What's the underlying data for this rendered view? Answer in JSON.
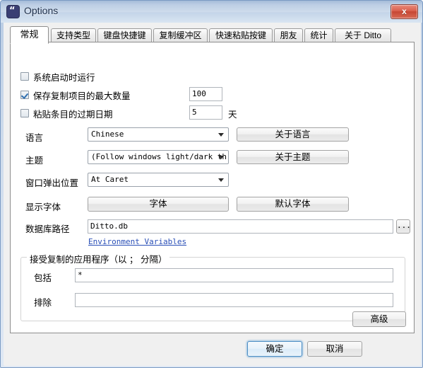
{
  "window": {
    "title": "Options",
    "icon": "ditto-quote-icon",
    "close_label": "x",
    "accent_blue": "#4f8fc4",
    "titlebar_color": "#cfdcec",
    "close_color": "#c64734"
  },
  "tabs": [
    {
      "label": "常规",
      "active": true
    },
    {
      "label": "支持类型",
      "active": false
    },
    {
      "label": "键盘快捷键",
      "active": false
    },
    {
      "label": "复制缓冲区",
      "active": false
    },
    {
      "label": "快速粘贴按键",
      "active": false
    },
    {
      "label": "朋友",
      "active": false
    },
    {
      "label": "统计",
      "active": false
    },
    {
      "label": "关于 Ditto",
      "active": false
    }
  ],
  "general": {
    "checkboxes": [
      {
        "label": "系统启动时运行",
        "checked": false
      },
      {
        "label": "保存复制项目的最大数量",
        "checked": true
      },
      {
        "label": "粘贴条目的过期日期",
        "checked": false
      }
    ],
    "max_copies_value": "100",
    "expire_days_value": "5",
    "expire_days_unit": "天",
    "language_label": "语言",
    "language_value": "Chinese",
    "language_button": "关于语言",
    "theme_label": "主题",
    "theme_value": "(Follow windows light/dark th",
    "theme_button": "关于主题",
    "popup_position_label": "窗口弹出位置",
    "popup_position_value": "At Caret",
    "display_font_label": "显示字体",
    "font_button": "字体",
    "default_font_button": "默认字体",
    "db_path_label": "数据库路径",
    "db_path_value": "Ditto.db",
    "browse_button": "...",
    "env_vars_link": "Environment Variables",
    "accept_group_title": "接受复制的应用程序（以 ； 分隔）",
    "include_label": "包括",
    "include_value": "*",
    "exclude_label": "排除",
    "exclude_value": "",
    "advanced_button": "高级"
  },
  "footer": {
    "ok_button": "确定",
    "cancel_button": "取消"
  }
}
